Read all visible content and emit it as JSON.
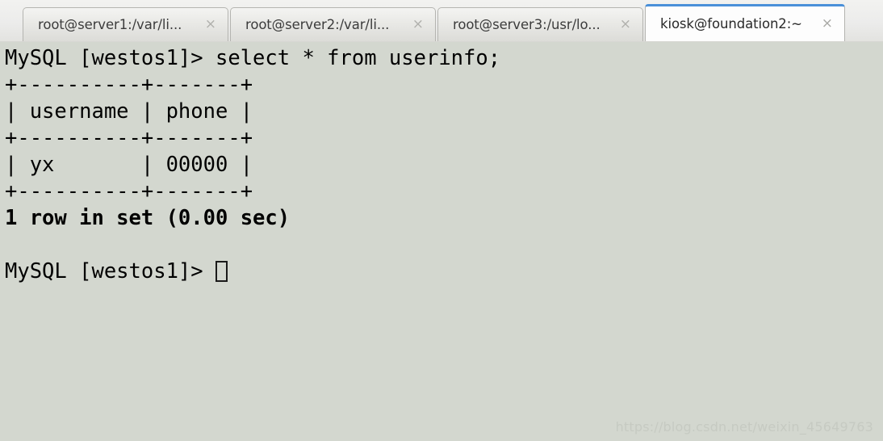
{
  "window": {
    "kind": "terminal-emulator"
  },
  "tabbar": {
    "tabs": [
      {
        "label": "root@server1:/var/li...",
        "close_icon": "×",
        "active": false
      },
      {
        "label": "root@server2:/var/li...",
        "close_icon": "×",
        "active": false
      },
      {
        "label": "root@server3:/usr/lo...",
        "close_icon": "×",
        "active": false
      },
      {
        "label": "kiosk@foundation2:~",
        "close_icon": "×",
        "active": true
      }
    ],
    "active_tab_accent": "#4a90d9"
  },
  "terminal": {
    "background": "#d3d7cf",
    "foreground": "#000000",
    "prompt": "MySQL [westos1]>",
    "command": "select * from userinfo;",
    "lines": [
      "MySQL [westos1]> select * from userinfo;",
      "+----------+-------+",
      "| username | phone |",
      "+----------+-------+",
      "| yx       | 00000 |",
      "+----------+-------+",
      "1 row in set (0.00 sec)",
      "",
      "MySQL [westos1]> "
    ],
    "result_table": {
      "columns": [
        "username",
        "phone"
      ],
      "rows": [
        [
          "yx",
          "00000"
        ]
      ],
      "row_count_text": "1 row in set (0.00 sec)"
    },
    "final_prompt": "MySQL [westos1]> ",
    "cursor_style": "hollow-block"
  },
  "watermark": {
    "text": "https://blog.csdn.net/weixin_45649763"
  }
}
